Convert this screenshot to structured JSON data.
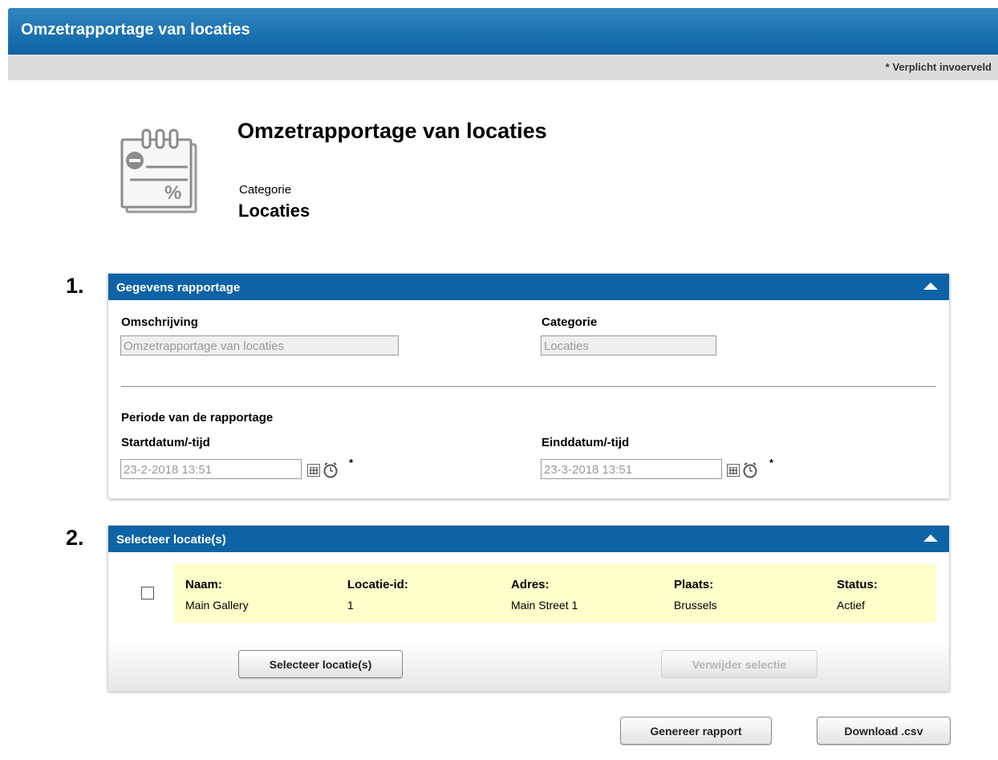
{
  "window": {
    "title": "Omzetrapportage van locaties",
    "required_note": "* Verplicht invoerveld"
  },
  "header": {
    "icon": "report-percent-icon",
    "title": "Omzetrapportage van locaties",
    "category_label": "Categorie",
    "category_value": "Locaties"
  },
  "section1": {
    "number": "1.",
    "title": "Gegevens rapportage",
    "description_label": "Omschrijving",
    "description_value": "Omzetrapportage van locaties",
    "category_label": "Categorie",
    "category_value": "Locaties",
    "period_label": "Periode van de rapportage",
    "start_label": "Startdatum/-tijd",
    "start_value": "23-2-2018 13:51",
    "end_label": "Einddatum/-tijd",
    "end_value": "23-3-2018 13:51",
    "required_mark": "*"
  },
  "section2": {
    "number": "2.",
    "title": "Selecteer locatie(s)",
    "columns": [
      "Naam:",
      "Locatie-id:",
      "Adres:",
      "Plaats:",
      "Status:"
    ],
    "rows": [
      [
        "Main Gallery",
        "1",
        "Main Street 1",
        "Brussels",
        "Actief"
      ]
    ],
    "select_button": "Selecteer locatie(s)",
    "remove_button": "Verwijder selectie"
  },
  "actions": {
    "generate_button": "Genereer rapport",
    "download_button": "Download .csv"
  },
  "colors": {
    "accent": "#0d63a5",
    "row_highlight": "#ffffcc"
  }
}
